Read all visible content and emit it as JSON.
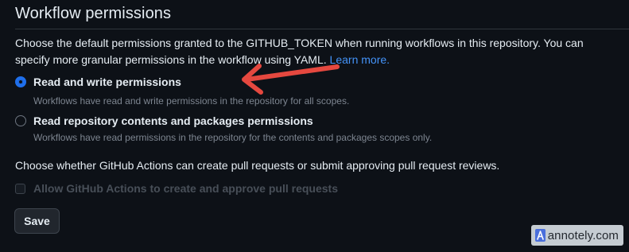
{
  "section": {
    "title": "Workflow permissions",
    "description": "Choose the default permissions granted to the GITHUB_TOKEN when running workflows in this repository. You can specify more granular permissions in the workflow using YAML.",
    "learn_more": "Learn more."
  },
  "permissions": {
    "options": [
      {
        "label": "Read and write permissions",
        "description": "Workflows have read and write permissions in the repository for all scopes.",
        "selected": true
      },
      {
        "label": "Read repository contents and packages permissions",
        "description": "Workflows have read permissions in the repository for the contents and packages scopes only.",
        "selected": false
      }
    ]
  },
  "pull_requests": {
    "question": "Choose whether GitHub Actions can create pull requests or submit approving pull request reviews.",
    "checkbox_label": "Allow GitHub Actions to create and approve pull requests",
    "checked": false,
    "disabled": true
  },
  "actions": {
    "save_label": "Save"
  },
  "annotation": {
    "arrow_color": "#e5483f"
  },
  "watermark": {
    "text": "annotely.com"
  },
  "colors": {
    "background": "#0d1117",
    "text": "#e6edf3",
    "muted": "#7d8590",
    "link": "#4493f8",
    "radio_selected": "#1f6feb"
  }
}
